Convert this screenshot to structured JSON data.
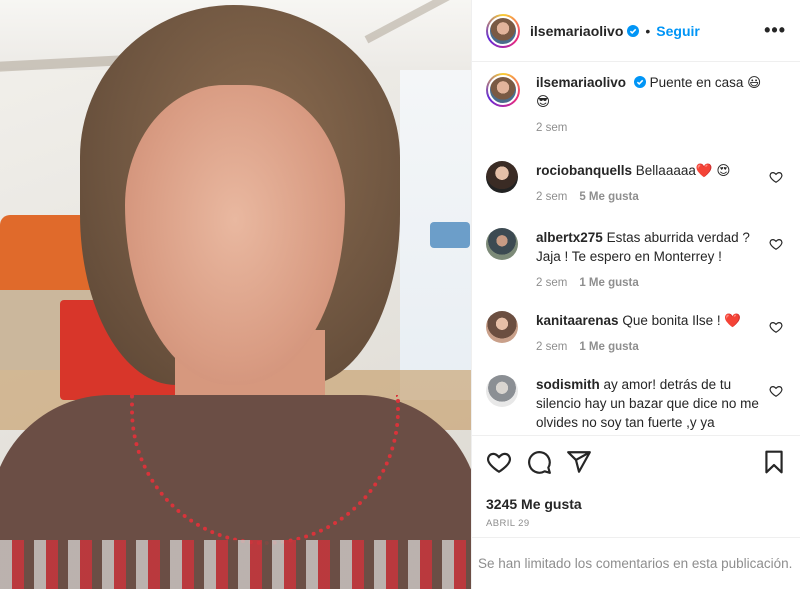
{
  "post": {
    "username": "ilsemariaolivo",
    "follow_label": "Seguir",
    "more_label": "•••",
    "caption": "Puente en casa 😃",
    "caption_line2": "😎",
    "caption_time": "2 sem"
  },
  "comments": [
    {
      "username": "rociobanquells",
      "text": "Bellaaaaa❤️ 😍",
      "time": "2 sem",
      "likes": "5 Me gusta"
    },
    {
      "username": "albertx275",
      "text": "Estas aburrida verdad ? Jaja ! Te espero en Monterrey !",
      "time": "2 sem",
      "likes": "1 Me gusta"
    },
    {
      "username": "kanitaarenas",
      "text": "Que bonita Ilse ! ❤️",
      "time": "2 sem",
      "likes": "1 Me gusta"
    },
    {
      "username": "sodismith",
      "text": "ay amor! detrás de tu silencio hay un bazar que dice no me olvides no soy tan fuerte ,y ya"
    }
  ],
  "stats": {
    "likes": "3245 Me gusta",
    "date": "ABRIL 29"
  },
  "footer": {
    "limited_text": "Se han limitado los comentarios en esta publicación."
  },
  "colors": {
    "accent": "#0095f6",
    "muted": "#8e8e8e",
    "text": "#262626"
  },
  "icons": [
    "verified-badge-icon",
    "heart-icon",
    "comment-icon",
    "share-icon",
    "bookmark-icon",
    "more-options-icon"
  ]
}
